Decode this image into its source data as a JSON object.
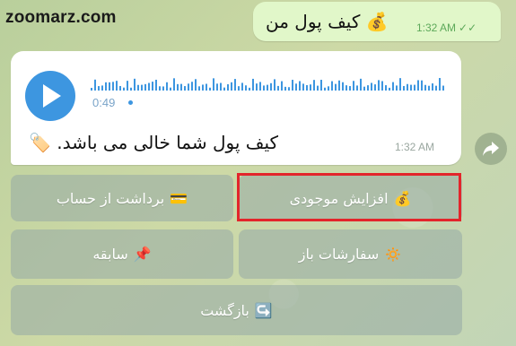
{
  "watermark": "zoomarz.com",
  "outgoing": {
    "text": "کیف پول من",
    "emoji": "💰",
    "time": "1:32 AM",
    "status_icon": "double-check-icon"
  },
  "incoming": {
    "voice_duration": "0:49",
    "text": "کیف پول شما خالی می باشد.",
    "emoji": "🏷️",
    "time": "1:32 AM"
  },
  "keyboard": {
    "increase_balance": {
      "label": "افزایش موجودی",
      "icon": "💰"
    },
    "withdraw": {
      "label": "برداشت از حساب",
      "icon": "💳"
    },
    "open_orders": {
      "label": "سفارشات باز",
      "icon": "🔅"
    },
    "history": {
      "label": "سابقه",
      "icon": "📌"
    },
    "back": {
      "label": "بازگشت",
      "icon": "↪️"
    }
  },
  "colors": {
    "accent": "#3d96e0",
    "highlight": "#e3252b",
    "outgoing_bubble": "#e1f7c9"
  }
}
